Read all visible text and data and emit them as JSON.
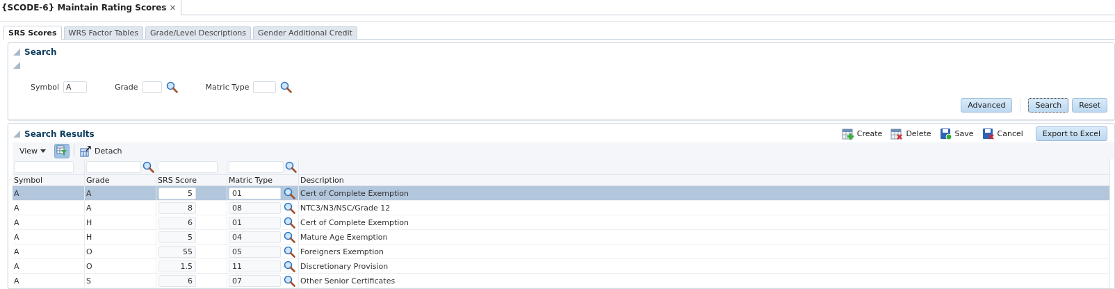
{
  "document_tab": {
    "title": "{SCODE-6} Maintain Rating Scores",
    "close": "×"
  },
  "tabs": [
    {
      "label": "SRS Scores",
      "selected": true
    },
    {
      "label": "WRS Factor Tables",
      "selected": false
    },
    {
      "label": "Grade/Level Descriptions",
      "selected": false
    },
    {
      "label": "Gender Additional Credit",
      "selected": false
    }
  ],
  "search": {
    "title": "Search",
    "fields": [
      {
        "label": "Symbol",
        "value": "A",
        "lookup": false
      },
      {
        "label": "Grade",
        "lookup": true
      },
      {
        "label": "Matric Type",
        "lookup": true
      }
    ],
    "buttons": [
      {
        "label": "Advanced",
        "focused": false
      },
      {
        "label": "Search",
        "focused": true
      },
      {
        "label": "Reset",
        "focused": false
      }
    ]
  },
  "results": {
    "title": "Search Results",
    "actions": [
      {
        "label": "Create",
        "kind": "create"
      },
      {
        "label": "Delete",
        "kind": "delete"
      },
      {
        "label": "Save",
        "kind": "save"
      },
      {
        "label": "Cancel",
        "kind": "cancel"
      }
    ],
    "export_button": "Export to Excel",
    "view_menu": "View",
    "filter_toggle": {
      "on": true
    },
    "detach": "Detach",
    "columns": [
      {
        "label": "Symbol",
        "filter": true,
        "lookup": false
      },
      {
        "label": "Grade",
        "filter": true,
        "lookup": true
      },
      {
        "label": "SRS Score",
        "filter": true,
        "lookup": false
      },
      {
        "label": "Matric Type",
        "filter": true,
        "lookup": true
      },
      {
        "label": "Description",
        "filter": false,
        "lookup": false
      }
    ],
    "rows": [
      {
        "symbol": "A",
        "grade": "A",
        "srs_score": "5",
        "matric_type": "01",
        "description": "Cert of Complete Exemption",
        "selected": true
      },
      {
        "symbol": "A",
        "grade": "A",
        "srs_score": "8",
        "matric_type": "08",
        "description": "NTC3/N3/NSC/Grade 12",
        "selected": false
      },
      {
        "symbol": "A",
        "grade": "H",
        "srs_score": "6",
        "matric_type": "01",
        "description": "Cert of Complete Exemption",
        "selected": false
      },
      {
        "symbol": "A",
        "grade": "H",
        "srs_score": "5",
        "matric_type": "04",
        "description": "Mature Age Exemption",
        "selected": false
      },
      {
        "symbol": "A",
        "grade": "O",
        "srs_score": "55",
        "matric_type": "05",
        "description": "Foreigners Exemption",
        "selected": false
      },
      {
        "symbol": "A",
        "grade": "O",
        "srs_score": "1.5",
        "matric_type": "11",
        "description": "Discretionary Provision",
        "selected": false
      },
      {
        "symbol": "A",
        "grade": "S",
        "srs_score": "6",
        "matric_type": "07",
        "description": "Other Senior Certificates",
        "selected": false
      }
    ]
  }
}
